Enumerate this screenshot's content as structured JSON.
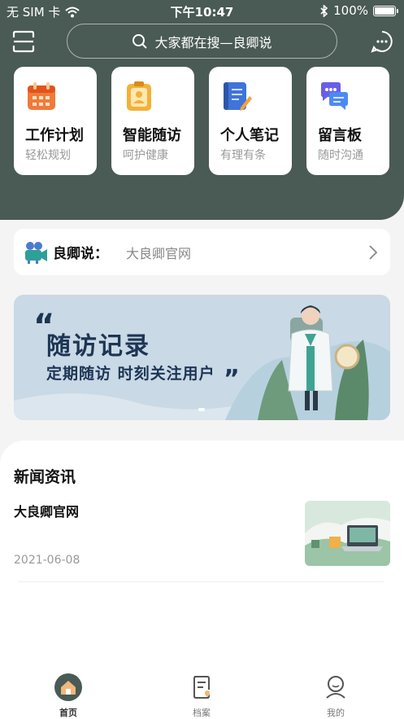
{
  "status": {
    "carrier": "无 SIM 卡",
    "time": "下午10:47",
    "battery": "100%"
  },
  "search": {
    "placeholder": "大家都在搜—良卿说"
  },
  "cards": [
    {
      "title": "工作计划",
      "subtitle": "轻松规划",
      "icon": "calendar-icon",
      "color": "#f07a3a"
    },
    {
      "title": "智能随访",
      "subtitle": "呵护健康",
      "icon": "clipboard-icon",
      "color": "#f2b13a"
    },
    {
      "title": "个人笔记",
      "subtitle": "有理有条",
      "icon": "notebook-icon",
      "color": "#3f74d9"
    },
    {
      "title": "留言板",
      "subtitle": "随时沟通",
      "icon": "chat-bubbles-icon",
      "color": "#6a5de8"
    }
  ],
  "notice": {
    "label": "良卿说：",
    "text": "大良卿官网"
  },
  "banner": {
    "line1": "随访记录",
    "line2": "定期随访 时刻关注用户",
    "page": 1,
    "page_count": 1
  },
  "news": {
    "heading": "新闻资讯",
    "items": [
      {
        "title": "大良卿官网",
        "date": "2021-06-08"
      }
    ]
  },
  "tabs": [
    {
      "label": "首页",
      "icon": "home-icon",
      "active": true
    },
    {
      "label": "档案",
      "icon": "archive-icon",
      "active": false
    },
    {
      "label": "我的",
      "icon": "profile-icon",
      "active": false
    }
  ],
  "colors": {
    "hero_bg": "#4a5a55",
    "page_bg": "#f4f4f4",
    "banner_bg": "#c9d9e5",
    "banner_text": "#1d3554"
  }
}
